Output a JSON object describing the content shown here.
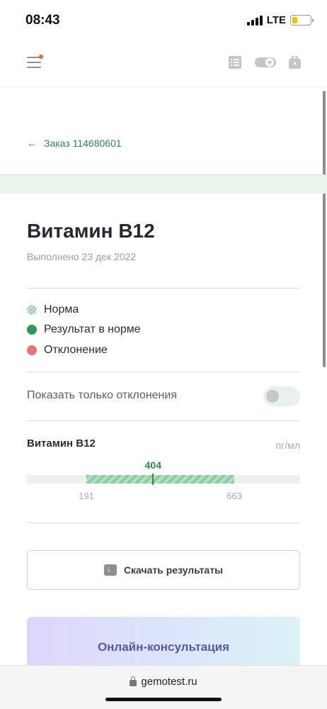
{
  "status_bar": {
    "time": "08:43",
    "network": "LTE"
  },
  "header": {
    "menu_icon": "hamburger-icon",
    "icons": [
      "list-icon",
      "toggle-plus-icon",
      "briefcase-icon"
    ]
  },
  "back_link": {
    "label": "Заказ 114680601"
  },
  "test": {
    "title": "Витамин B12",
    "completed": "Выполнено 23 дек 2022"
  },
  "legend": [
    {
      "label": "Норма",
      "color": "#9fcfae"
    },
    {
      "label": "Результат в норме",
      "color": "#2e9a58"
    },
    {
      "label": "Отклонение",
      "color": "#e87470"
    }
  ],
  "filter": {
    "label": "Показать только отклонения",
    "enabled": false
  },
  "analyte": {
    "name": "Витамин B12",
    "unit": "пг/мл",
    "value": 404,
    "value_label": "404",
    "ref_low": 191,
    "ref_low_label": "191",
    "ref_high": 663,
    "ref_high_label": "663"
  },
  "actions": {
    "download_label": "Скачать результаты"
  },
  "consult": {
    "label": "Онлайн-консультация"
  },
  "browser": {
    "url": "gemotest.ru"
  },
  "colors": {
    "accent_green": "#2e8a4f",
    "deviation_red": "#e87470",
    "consult_text": "#5d55a8"
  }
}
